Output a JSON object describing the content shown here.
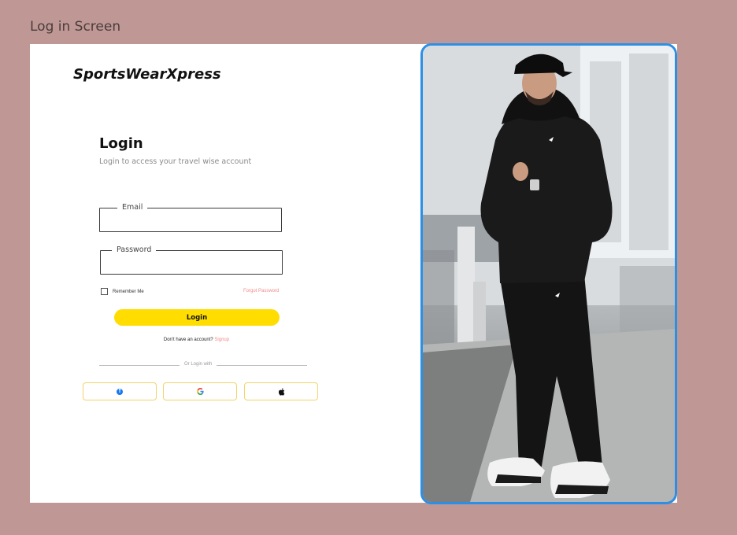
{
  "frame_label": "Log in Screen",
  "brand": "SportsWearXpress",
  "login": {
    "title": "Login",
    "subtitle": "Login to access your travel wise  account",
    "email_label": "Email",
    "password_label": "Password",
    "remember_label": "Remember Me",
    "forgot_label": "Forgot Password",
    "button_label": "Login",
    "no_account_text": "Don't have an account?",
    "signup_label": "Signup",
    "divider_text": "Or Login with"
  },
  "social": [
    {
      "name": "facebook",
      "icon": "facebook-icon"
    },
    {
      "name": "google",
      "icon": "google-icon"
    },
    {
      "name": "apple",
      "icon": "apple-icon"
    }
  ],
  "colors": {
    "accent": "#ffdd00",
    "link": "#f08a8a",
    "photo_border": "#2b8fe6",
    "background": "#bf9895"
  }
}
